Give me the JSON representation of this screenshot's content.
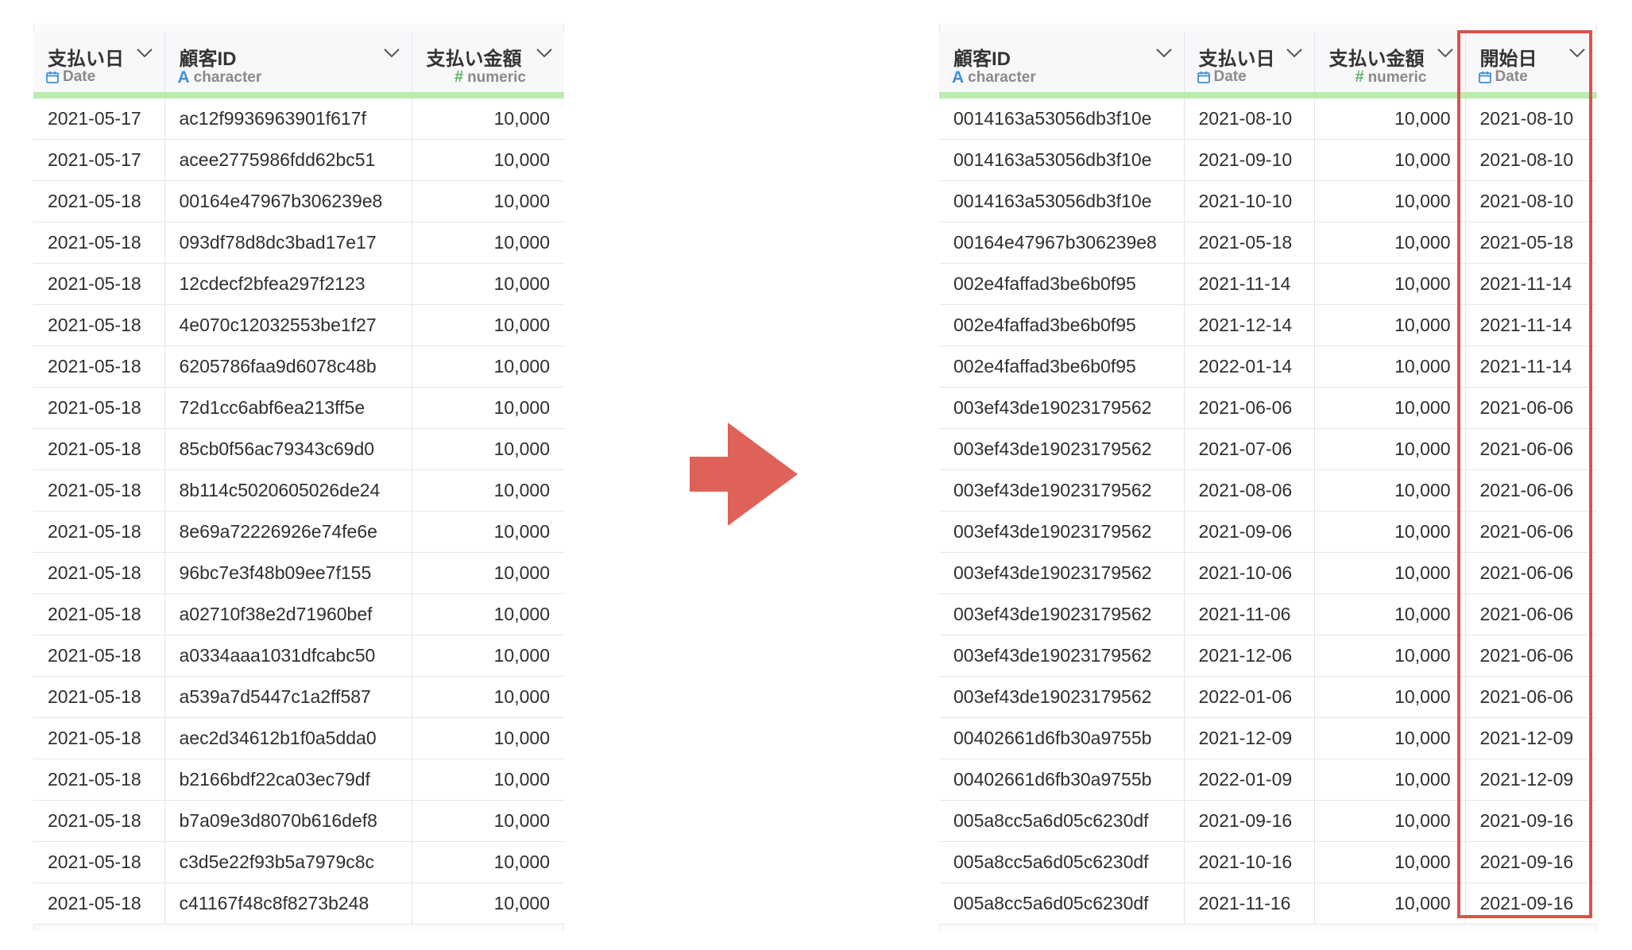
{
  "left_table": {
    "columns": [
      {
        "name": "支払い日",
        "type": "Date",
        "icon": "calendar-icon"
      },
      {
        "name": "顧客ID",
        "type": "character",
        "icon": "character-type-icon"
      },
      {
        "name": "支払い金額",
        "type": "numeric",
        "icon": "hash-icon"
      }
    ],
    "rows": [
      [
        "2021-05-17",
        "ac12f9936963901f617f",
        "10,000"
      ],
      [
        "2021-05-17",
        "acee2775986fdd62bc51",
        "10,000"
      ],
      [
        "2021-05-18",
        "00164e47967b306239e8",
        "10,000"
      ],
      [
        "2021-05-18",
        "093df78d8dc3bad17e17",
        "10,000"
      ],
      [
        "2021-05-18",
        "12cdecf2bfea297f2123",
        "10,000"
      ],
      [
        "2021-05-18",
        "4e070c12032553be1f27",
        "10,000"
      ],
      [
        "2021-05-18",
        "6205786faa9d6078c48b",
        "10,000"
      ],
      [
        "2021-05-18",
        "72d1cc6abf6ea213ff5e",
        "10,000"
      ],
      [
        "2021-05-18",
        "85cb0f56ac79343c69d0",
        "10,000"
      ],
      [
        "2021-05-18",
        "8b114c5020605026de24",
        "10,000"
      ],
      [
        "2021-05-18",
        "8e69a72226926e74fe6e",
        "10,000"
      ],
      [
        "2021-05-18",
        "96bc7e3f48b09ee7f155",
        "10,000"
      ],
      [
        "2021-05-18",
        "a02710f38e2d71960bef",
        "10,000"
      ],
      [
        "2021-05-18",
        "a0334aaa1031dfcabc50",
        "10,000"
      ],
      [
        "2021-05-18",
        "a539a7d5447c1a2ff587",
        "10,000"
      ],
      [
        "2021-05-18",
        "aec2d34612b1f0a5dda0",
        "10,000"
      ],
      [
        "2021-05-18",
        "b2166bdf22ca03ec79df",
        "10,000"
      ],
      [
        "2021-05-18",
        "b7a09e3d8070b616def8",
        "10,000"
      ],
      [
        "2021-05-18",
        "c3d5e22f93b5a7979c8c",
        "10,000"
      ],
      [
        "2021-05-18",
        "c41167f48c8f8273b248",
        "10,000"
      ]
    ]
  },
  "right_table": {
    "columns": [
      {
        "name": "顧客ID",
        "type": "character",
        "icon": "character-type-icon"
      },
      {
        "name": "支払い日",
        "type": "Date",
        "icon": "calendar-icon"
      },
      {
        "name": "支払い金額",
        "type": "numeric",
        "icon": "hash-icon"
      },
      {
        "name": "開始日",
        "type": "Date",
        "icon": "calendar-icon"
      }
    ],
    "rows": [
      [
        "0014163a53056db3f10e",
        "2021-08-10",
        "10,000",
        "2021-08-10"
      ],
      [
        "0014163a53056db3f10e",
        "2021-09-10",
        "10,000",
        "2021-08-10"
      ],
      [
        "0014163a53056db3f10e",
        "2021-10-10",
        "10,000",
        "2021-08-10"
      ],
      [
        "00164e47967b306239e8",
        "2021-05-18",
        "10,000",
        "2021-05-18"
      ],
      [
        "002e4faffad3be6b0f95",
        "2021-11-14",
        "10,000",
        "2021-11-14"
      ],
      [
        "002e4faffad3be6b0f95",
        "2021-12-14",
        "10,000",
        "2021-11-14"
      ],
      [
        "002e4faffad3be6b0f95",
        "2022-01-14",
        "10,000",
        "2021-11-14"
      ],
      [
        "003ef43de19023179562",
        "2021-06-06",
        "10,000",
        "2021-06-06"
      ],
      [
        "003ef43de19023179562",
        "2021-07-06",
        "10,000",
        "2021-06-06"
      ],
      [
        "003ef43de19023179562",
        "2021-08-06",
        "10,000",
        "2021-06-06"
      ],
      [
        "003ef43de19023179562",
        "2021-09-06",
        "10,000",
        "2021-06-06"
      ],
      [
        "003ef43de19023179562",
        "2021-10-06",
        "10,000",
        "2021-06-06"
      ],
      [
        "003ef43de19023179562",
        "2021-11-06",
        "10,000",
        "2021-06-06"
      ],
      [
        "003ef43de19023179562",
        "2021-12-06",
        "10,000",
        "2021-06-06"
      ],
      [
        "003ef43de19023179562",
        "2022-01-06",
        "10,000",
        "2021-06-06"
      ],
      [
        "00402661d6fb30a9755b",
        "2021-12-09",
        "10,000",
        "2021-12-09"
      ],
      [
        "00402661d6fb30a9755b",
        "2022-01-09",
        "10,000",
        "2021-12-09"
      ],
      [
        "005a8cc5a6d05c6230df",
        "2021-09-16",
        "10,000",
        "2021-09-16"
      ],
      [
        "005a8cc5a6d05c6230df",
        "2021-10-16",
        "10,000",
        "2021-09-16"
      ],
      [
        "005a8cc5a6d05c6230df",
        "2021-11-16",
        "10,000",
        "2021-09-16"
      ]
    ]
  },
  "colors": {
    "header_accent": "#b9ecae",
    "arrow": "#df6259",
    "highlight_border": "#e0504a",
    "character_icon": "#3d8fd8",
    "numeric_icon": "#5bb55b",
    "date_icon": "#3d8fd8"
  }
}
